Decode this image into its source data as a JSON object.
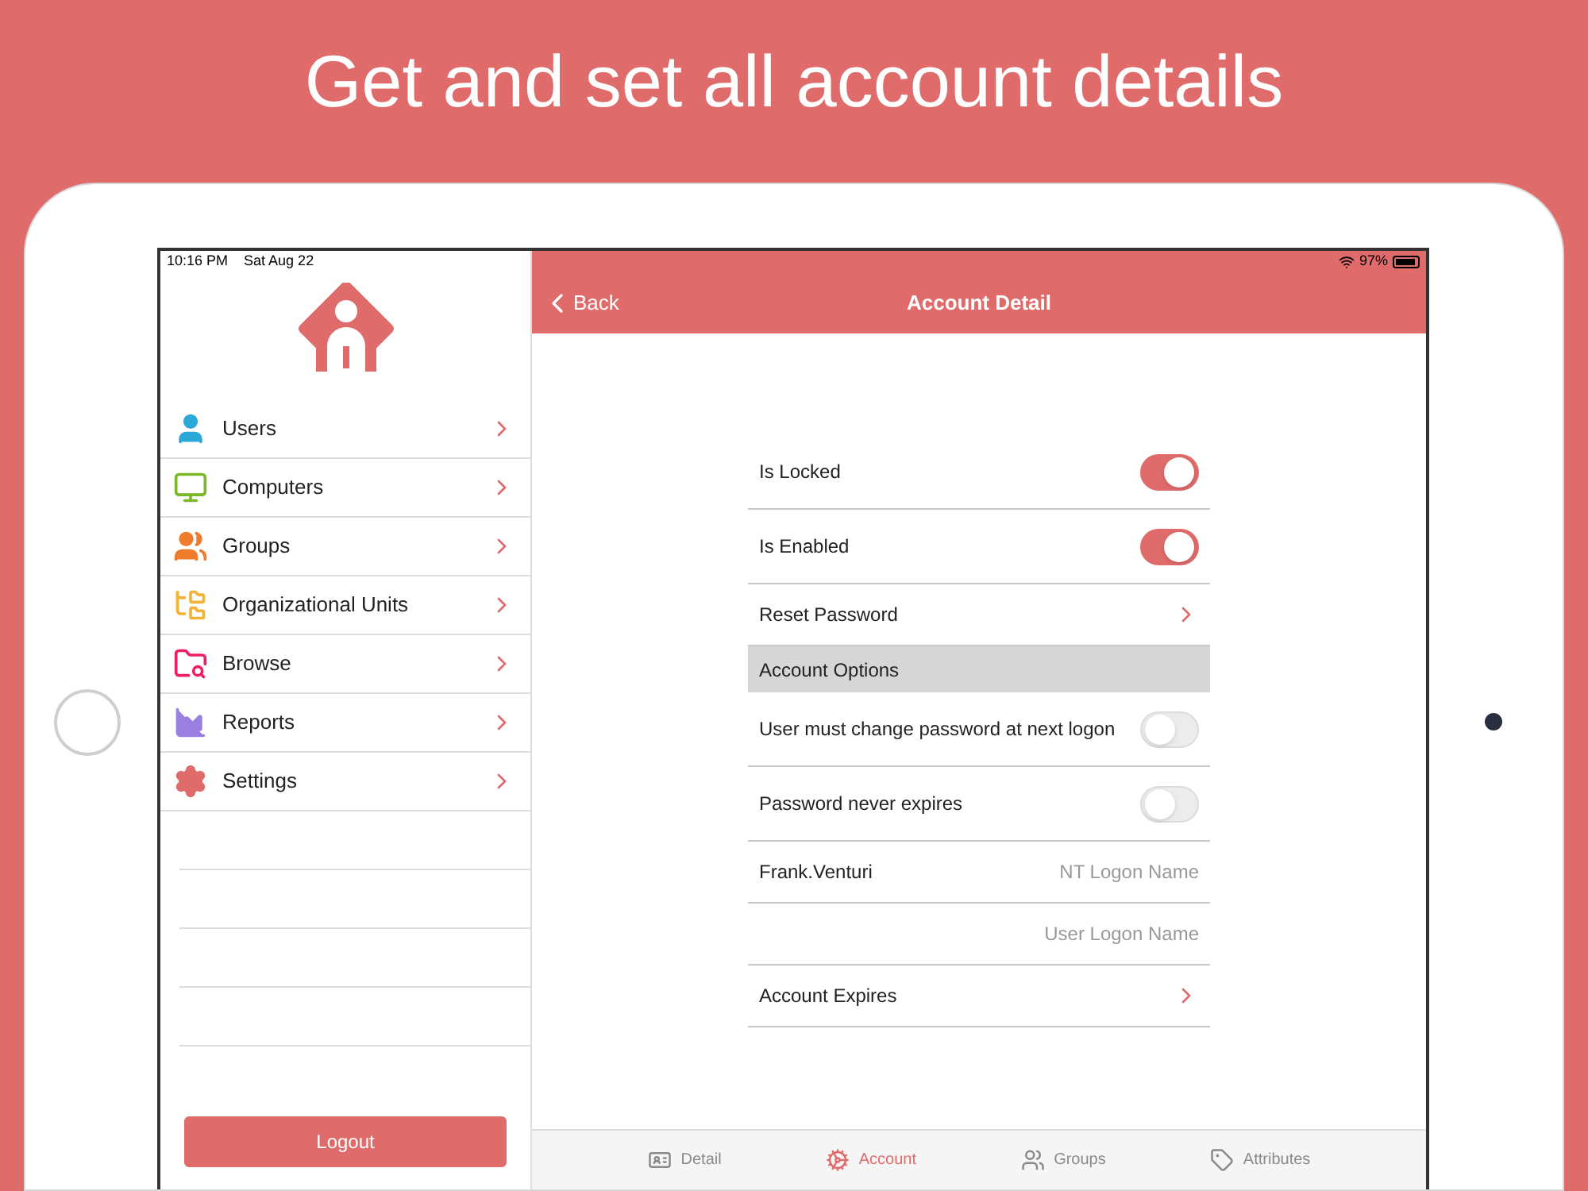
{
  "headline": "Get and set all account details",
  "status_bar": {
    "time": "10:16 PM",
    "date": "Sat Aug 22",
    "battery": "97%"
  },
  "sidebar": {
    "items": [
      {
        "label": "Users",
        "color": "#2aa8d8"
      },
      {
        "label": "Computers",
        "color": "#7ab828"
      },
      {
        "label": "Groups",
        "color": "#ef7b2c"
      },
      {
        "label": "Organizational Units",
        "color": "#f5b335"
      },
      {
        "label": "Browse",
        "color": "#ee1f61"
      },
      {
        "label": "Reports",
        "color": "#9b7fe0"
      },
      {
        "label": "Settings",
        "color": "#e06b6b"
      }
    ],
    "logout": "Logout"
  },
  "header": {
    "back": "Back",
    "title": "Account Detail"
  },
  "rows": [
    {
      "kind": "toggle",
      "label": "Is Locked",
      "on": true
    },
    {
      "kind": "toggle",
      "label": "Is Enabled",
      "on": true
    },
    {
      "kind": "link",
      "label": "Reset Password"
    },
    {
      "kind": "header",
      "label": "Account Options"
    },
    {
      "kind": "toggle",
      "label": "User must change password at next logon",
      "on": false
    },
    {
      "kind": "toggle",
      "label": "Password never expires",
      "on": false
    },
    {
      "kind": "field",
      "account_name": "Frank.Venturi",
      "caption": "NT Logon Name"
    },
    {
      "kind": "field",
      "caption": "User Logon Name"
    },
    {
      "kind": "link",
      "label": "Account Expires"
    }
  ],
  "tabs": [
    {
      "label": "Detail",
      "selected": false
    },
    {
      "label": "Account",
      "selected": true
    },
    {
      "label": "Groups",
      "selected": false
    },
    {
      "label": "Attributes",
      "selected": false
    }
  ]
}
